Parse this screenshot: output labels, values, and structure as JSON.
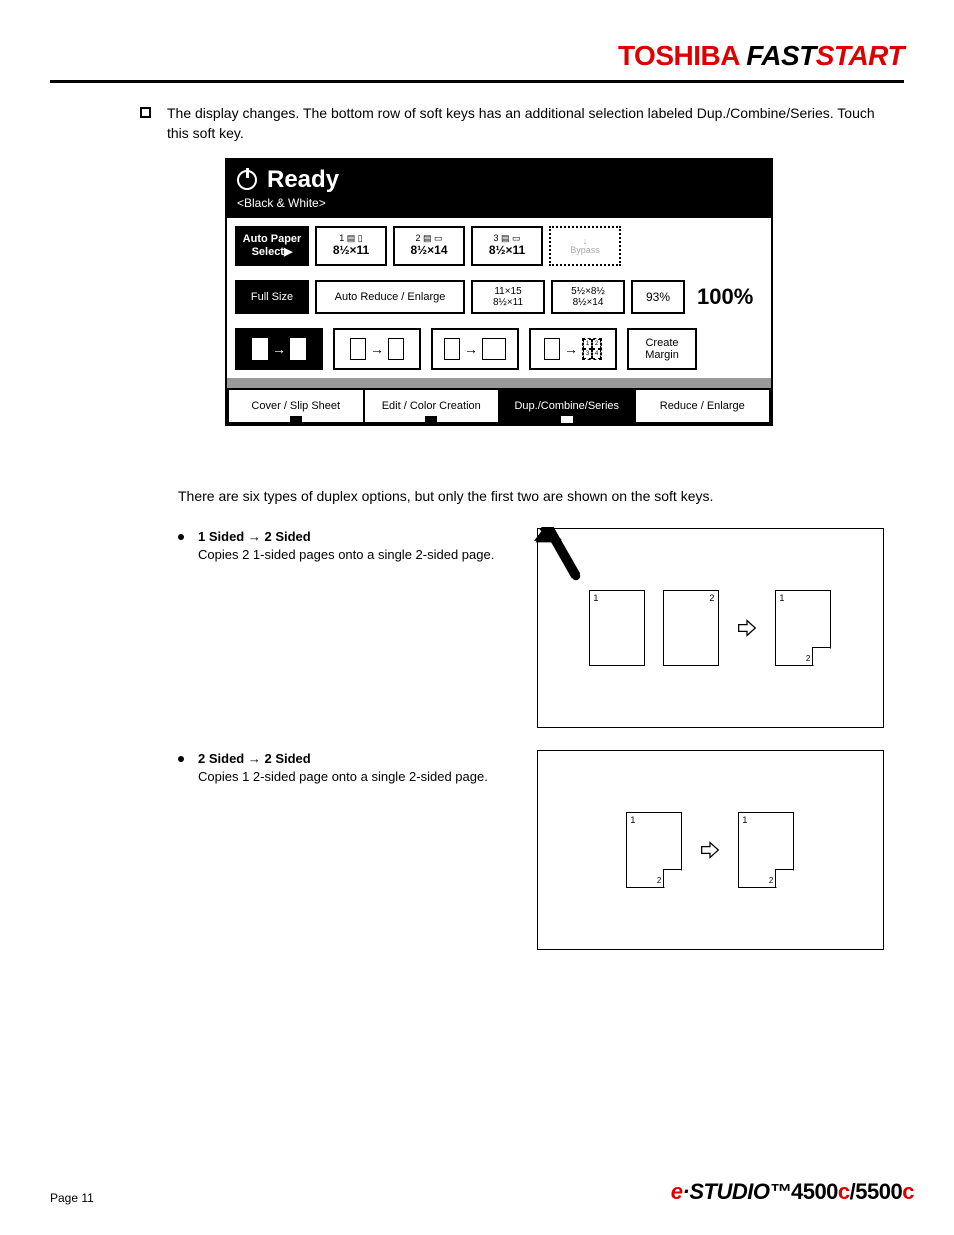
{
  "header": {
    "brand1": "TOSHIBA",
    "brand2a": "FAST",
    "brand2b": "START"
  },
  "intro": "The display changes. The bottom row of soft keys has an additional selection labeled Dup./Combine/Series. Touch this soft key.",
  "screen": {
    "ready": "Ready",
    "mode": "<Black & White>",
    "auto_paper": "Auto Paper Select▶",
    "trays": [
      {
        "idx": "1",
        "size": "8½×11"
      },
      {
        "idx": "2",
        "size": "8½×14"
      },
      {
        "idx": "3",
        "size": "8½×11"
      }
    ],
    "bypass": "Bypass",
    "full_size": "Full Size",
    "auto_re": "Auto Reduce / Enlarge",
    "zoom1_top": "11×15",
    "zoom1_bot": "8½×11",
    "zoom2_top": "5½×8½",
    "zoom2_bot": "8½×14",
    "pct_small": "93%",
    "pct_big": "100%",
    "create_margin": "Create Margin",
    "tabs": [
      "Cover / Slip Sheet",
      "Edit / Color Creation",
      "Dup./Combine/Series",
      "Reduce / Enlarge"
    ]
  },
  "post": "There are six types of duplex options, but only the first two are shown on the soft keys.",
  "opts": [
    {
      "title_l": "1 Sided",
      "title_r": "2 Sided",
      "desc": "Copies 2 1-sided pages onto a single 2-sided page."
    },
    {
      "title_l": "2 Sided",
      "title_r": "2 Sided",
      "desc": "Copies 1 2-sided page onto a single 2-sided page."
    }
  ],
  "diagram_labels": {
    "one": "1",
    "two": "2"
  },
  "footer": {
    "page": "Page  11",
    "brand_e": "e",
    "brand_studio": "·STUDIO™",
    "model_a": "4500",
    "model_c1": "c",
    "slash": "/",
    "model_b": "5500",
    "model_c2": "c"
  }
}
